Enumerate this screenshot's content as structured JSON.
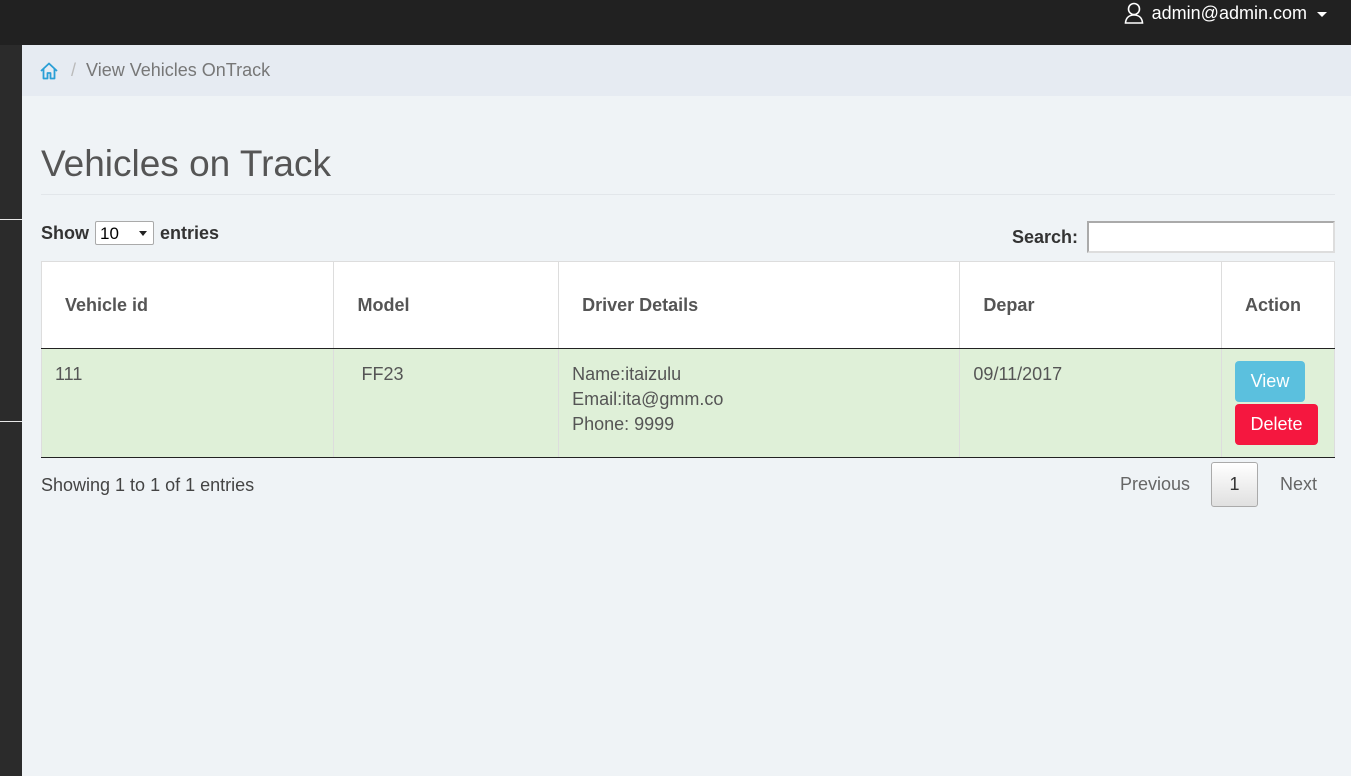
{
  "topbar": {
    "user_label": "admin@admin.com"
  },
  "breadcrumb": {
    "current": "View Vehicles OnTrack"
  },
  "page": {
    "title": "Vehicles on Track"
  },
  "table_controls": {
    "show_label": "Show",
    "entries_label": "entries",
    "page_length": "10",
    "search_label": "Search:",
    "search_value": ""
  },
  "table": {
    "columns": [
      "Vehicle id",
      "Model",
      "Driver Details",
      "Depar",
      "Action"
    ],
    "rows": [
      {
        "vehicle_id": "111",
        "model": "FF23",
        "driver_name": "Name:itaizulu",
        "driver_email": "Email:ita@gmm.co",
        "driver_phone": "Phone: 9999",
        "departure": "09/11/2017",
        "view_label": "View",
        "delete_label": "Delete"
      }
    ]
  },
  "footer": {
    "info": "Showing 1 to 1 of 1 entries",
    "previous_label": "Previous",
    "current_page": "1",
    "next_label": "Next"
  },
  "colors": {
    "topbar": "#212121",
    "row_success": "#dff0d8",
    "view_button": "#5bc0de",
    "delete_button": "#f5173f",
    "home_icon": "#2a9fd6"
  }
}
